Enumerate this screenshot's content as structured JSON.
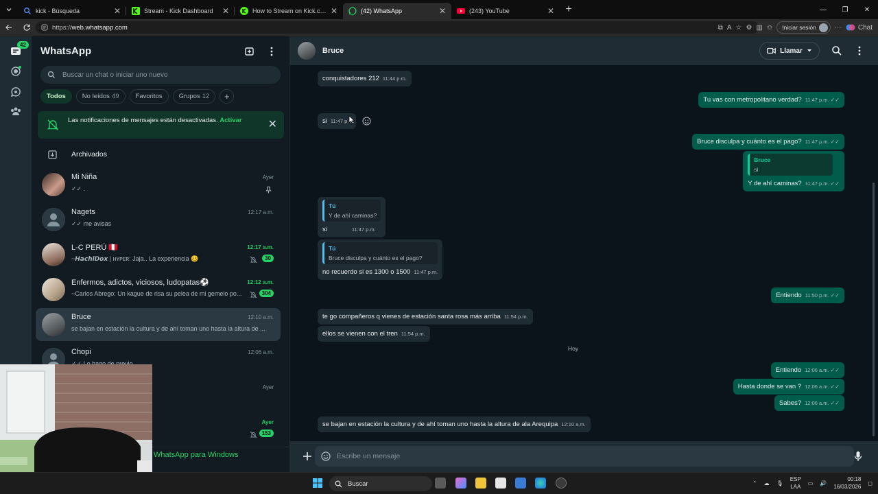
{
  "browser": {
    "tabs": [
      {
        "title": "kick - Búsqueda",
        "icon": "search-icon"
      },
      {
        "title": "Stream - Kick Dashboard",
        "icon": "kick-logo-icon"
      },
      {
        "title": "How to Stream on Kick.com | Kick Help",
        "icon": "kick-circle-icon"
      },
      {
        "title": "(42) WhatsApp",
        "icon": "whatsapp-icon",
        "active": true
      },
      {
        "title": "(243) YouTube",
        "icon": "youtube-icon"
      }
    ],
    "url_prefix": "https://",
    "url_host": "web.whatsapp.com",
    "signin_label": "Iniciar sesión",
    "copilot_label": "Chat"
  },
  "rail": {
    "badge": "42"
  },
  "sidebar": {
    "title": "WhatsApp",
    "search_placeholder": "Buscar un chat o iniciar uno nuevo",
    "filters": [
      {
        "label": "Todos",
        "count": "",
        "active": true
      },
      {
        "label": "No leídos",
        "count": "49"
      },
      {
        "label": "Favoritos",
        "count": ""
      },
      {
        "label": "Grupos",
        "count": "12"
      }
    ],
    "notice": {
      "text": "Las notificaciones de mensajes están desactivadas.",
      "action": "Activar"
    },
    "archived_label": "Archivados",
    "chats": [
      {
        "name": "Mi Niña",
        "time": "Ayer",
        "preview": "✓✓ .",
        "pinned": true
      },
      {
        "name": "Nagets",
        "time": "12:17 a.m.",
        "preview": "✓✓ me avisas"
      },
      {
        "name": "L-C PERÚ 🇵🇪",
        "time": "12:17 a.m.",
        "preview": "~𝙃𝙖𝙘𝙝𝙞𝘿𝙤𝙭 | ʜʏᴘᴇʀ: Jaja.. La experiencia 🥴",
        "unread": "30",
        "muted": true
      },
      {
        "name": "Enfermos, adictos, viciosos, ludopatas⚽",
        "time": "12:12 a.m.",
        "preview": "~Carlos Abrego: Un kague de risa su pelea de mi gemelo po...",
        "unread": "304",
        "muted": true
      },
      {
        "name": "Bruce",
        "time": "12:10 a.m.",
        "preview": "se bajan en estación la cultura y de ahí toman uno hasta la altura de ...",
        "selected": true
      },
      {
        "name": "Chopi",
        "time": "12:06 a.m.",
        "preview": "✓✓ Lo hago de previo"
      },
      {
        "name": "",
        "time": "Ayer",
        "preview": ""
      },
      {
        "name": "",
        "time": "Ayer",
        "preview": "",
        "unread": "153",
        "muted": true
      }
    ],
    "get_app": "WhatsApp para Windows"
  },
  "conversation": {
    "contact": "Bruce",
    "call_label": "Llamar",
    "day_label": "Hoy",
    "compose_placeholder": "Escribe un mensaje",
    "messages": [
      {
        "dir": "in",
        "text": "conquistadores 212",
        "time": "11:44 p.m."
      },
      {
        "dir": "out",
        "text": "Tu vas con metropolitano verdad?",
        "time": "11:47 p.m."
      },
      {
        "dir": "in",
        "text": "si",
        "time": "11:47 p.m."
      },
      {
        "dir": "out",
        "text": "Bruce disculpa y cuánto es el pago?",
        "time": "11:47 p.m."
      },
      {
        "dir": "out",
        "quote_author": "Bruce",
        "quote_text": "si",
        "text": "Y de ahí caminas?",
        "time": "11:47 p.m."
      },
      {
        "dir": "in",
        "quote_author": "Tú",
        "quote_text": "Y de ahí caminas?",
        "text": "si",
        "time": "11:47 p.m."
      },
      {
        "dir": "in",
        "quote_author": "Tú",
        "quote_text": "Bruce disculpa y cuánto es el pago?",
        "text": "no recuerdo si es 1300 o 1500",
        "time": "11:47 p.m."
      },
      {
        "dir": "out",
        "text": "Entiendo",
        "time": "11:50 p.m."
      },
      {
        "dir": "in",
        "text": "te go compañeros q vienes de estación santa rosa más arriba",
        "time": "11:54 p.m."
      },
      {
        "dir": "in",
        "text": "ellos se vienen con el tren",
        "time": "11:54 p.m."
      },
      {
        "dir": "out",
        "text": "Entiendo",
        "time": "12:06 a.m."
      },
      {
        "dir": "out",
        "text": "Hasta donde se van ?",
        "time": "12:06 a.m."
      },
      {
        "dir": "out",
        "text": "Sabes?",
        "time": "12:06 a.m."
      },
      {
        "dir": "in",
        "text": "se bajan en estación la cultura y de ahí toman uno hasta la altura de ala Arequipa",
        "time": "12:10 a.m."
      }
    ]
  },
  "taskbar": {
    "search_label": "Buscar",
    "lang": "ESP",
    "lang2": "LAA",
    "time": "00:18",
    "date": "16/03/2026"
  },
  "colors": {
    "accent": "#25d366",
    "outgoing_bubble": "#005c4b",
    "incoming_bubble": "#202c33",
    "background": "#0b141a"
  }
}
